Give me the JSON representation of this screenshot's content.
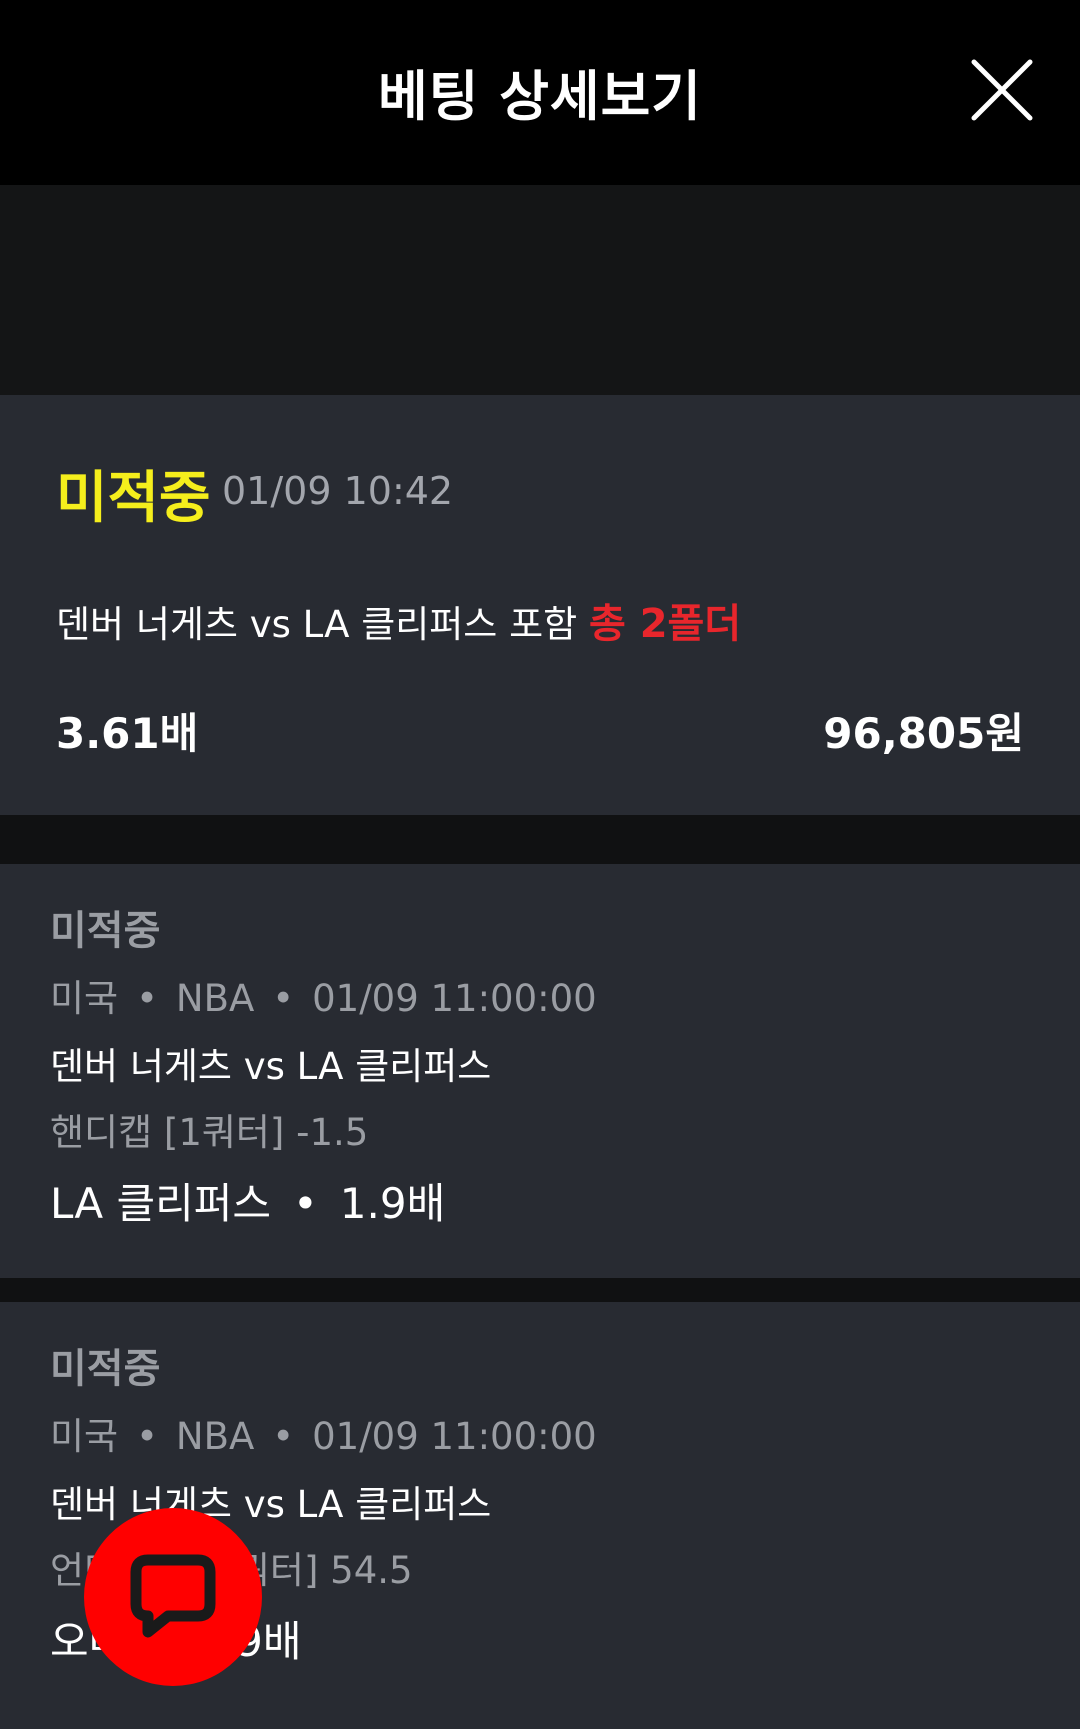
{
  "header": {
    "title": "베팅 상세보기",
    "close_icon": "close-icon"
  },
  "summary": {
    "status": "미적중",
    "datetime": "01/09 10:42",
    "description": "덴버 너게츠 vs LA 클리퍼스 포함",
    "folder_count": "총 2폴더",
    "total_odds": "3.61배",
    "amount": "96,805원",
    "colors": {
      "status": "#f5ee1c",
      "folder": "#e8262c"
    }
  },
  "bets": [
    {
      "status": "미적중",
      "country": "미국",
      "league": "NBA",
      "datetime": "01/09 11:00:00",
      "match": "덴버 너게츠 vs LA 클리퍼스",
      "market": "핸디캡 [1쿼터] -1.5",
      "pick": "LA 클리퍼스",
      "odds": "1.9배"
    },
    {
      "status": "미적중",
      "country": "미국",
      "league": "NBA",
      "datetime": "01/09 11:00:00",
      "match": "덴버 너게츠 vs LA 클리퍼스",
      "market": "언더오버 [1쿼터] 54.5",
      "pick": "오버",
      "odds": "1.9배"
    }
  ],
  "chat_button": {
    "icon": "chat-bubble-icon",
    "color": "#ff0000"
  },
  "separator": "•"
}
